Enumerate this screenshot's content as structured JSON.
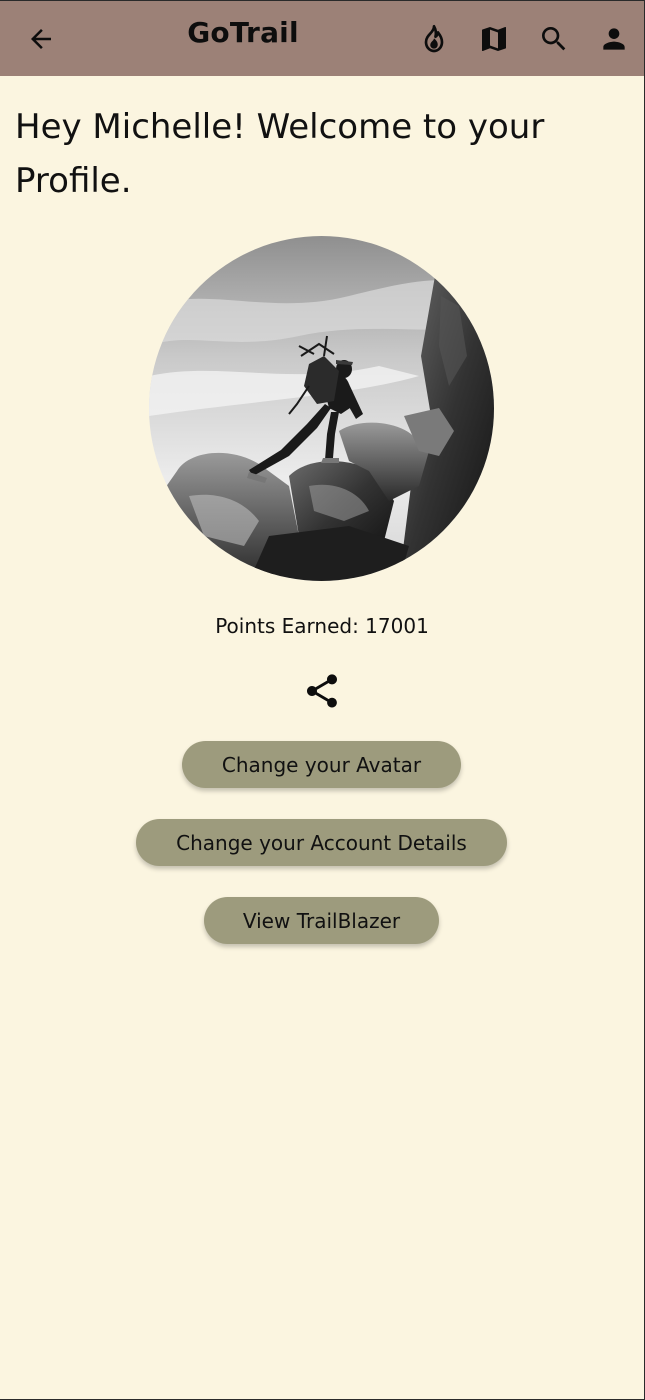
{
  "app_bar": {
    "title": "GoTrail",
    "icons": [
      "arrow-back-icon",
      "fire-icon",
      "map-icon",
      "search-icon",
      "person-icon"
    ]
  },
  "profile": {
    "greeting": "Hey Michelle! Welcome to your Profile.",
    "avatar_icon": "hiker-photo",
    "points_label": "Points Earned: 17001"
  },
  "actions": {
    "share_icon": "share-icon",
    "change_avatar": "Change your Avatar",
    "change_account": "Change your Account Details",
    "view_trailblazer": "View TrailBlazer"
  },
  "colors": {
    "app_bar": "#9c8177",
    "background": "#fbf5e0",
    "button": "#9d9b7d"
  }
}
